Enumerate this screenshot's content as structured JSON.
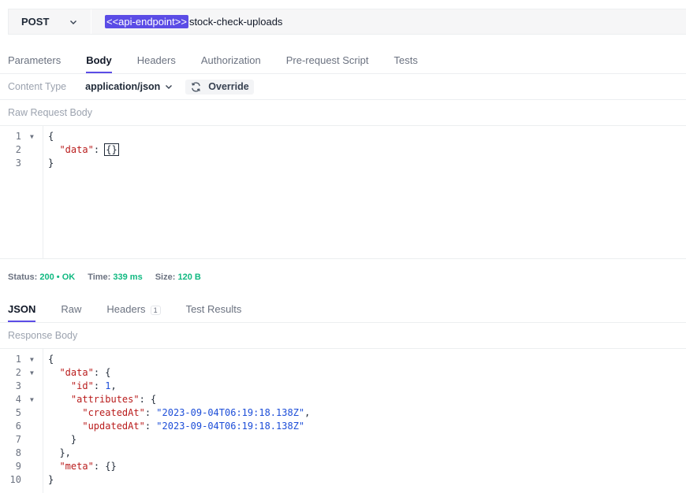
{
  "request": {
    "method": "POST",
    "url_variable": "<<api-endpoint>>",
    "url_path": "stock-check-uploads"
  },
  "request_tabs": [
    {
      "label": "Parameters",
      "active": false
    },
    {
      "label": "Body",
      "active": true
    },
    {
      "label": "Headers",
      "active": false
    },
    {
      "label": "Authorization",
      "active": false
    },
    {
      "label": "Pre-request Script",
      "active": false
    },
    {
      "label": "Tests",
      "active": false
    }
  ],
  "content_type": {
    "label": "Content Type",
    "value": "application/json",
    "override_label": "Override"
  },
  "raw_body_label": "Raw Request Body",
  "request_body_lines": [
    {
      "n": "1",
      "fold": true
    },
    {
      "n": "2",
      "fold": false
    },
    {
      "n": "3",
      "fold": false
    }
  ],
  "status": {
    "status_label": "Status:",
    "status_code": "200",
    "status_text": "OK",
    "time_label": "Time:",
    "time_value": "339 ms",
    "size_label": "Size:",
    "size_value": "120 B"
  },
  "response_tabs": [
    {
      "label": "JSON",
      "active": true
    },
    {
      "label": "Raw",
      "active": false
    },
    {
      "label": "Headers",
      "active": false,
      "badge": "1"
    },
    {
      "label": "Test Results",
      "active": false
    }
  ],
  "response_body_label": "Response Body",
  "response_lines": [
    {
      "n": "1",
      "fold": true
    },
    {
      "n": "2",
      "fold": true
    },
    {
      "n": "3",
      "fold": false
    },
    {
      "n": "4",
      "fold": true
    },
    {
      "n": "5",
      "fold": false
    },
    {
      "n": "6",
      "fold": false
    },
    {
      "n": "7",
      "fold": false
    },
    {
      "n": "8",
      "fold": false
    },
    {
      "n": "9",
      "fold": false
    },
    {
      "n": "10",
      "fold": false
    }
  ],
  "response_json": {
    "key_data": "\"data\"",
    "key_id": "\"id\"",
    "id_value": "1",
    "key_attributes": "\"attributes\"",
    "key_created": "\"createdAt\"",
    "created_value": "\"2023-09-04T06:19:18.138Z\"",
    "key_updated": "\"updatedAt\"",
    "updated_value": "\"2023-09-04T06:19:18.138Z\"",
    "key_meta": "\"meta\""
  },
  "request_json": {
    "key_data": "\"data\""
  },
  "colors": {
    "accent": "#5b4ce6",
    "success": "#10b981"
  }
}
